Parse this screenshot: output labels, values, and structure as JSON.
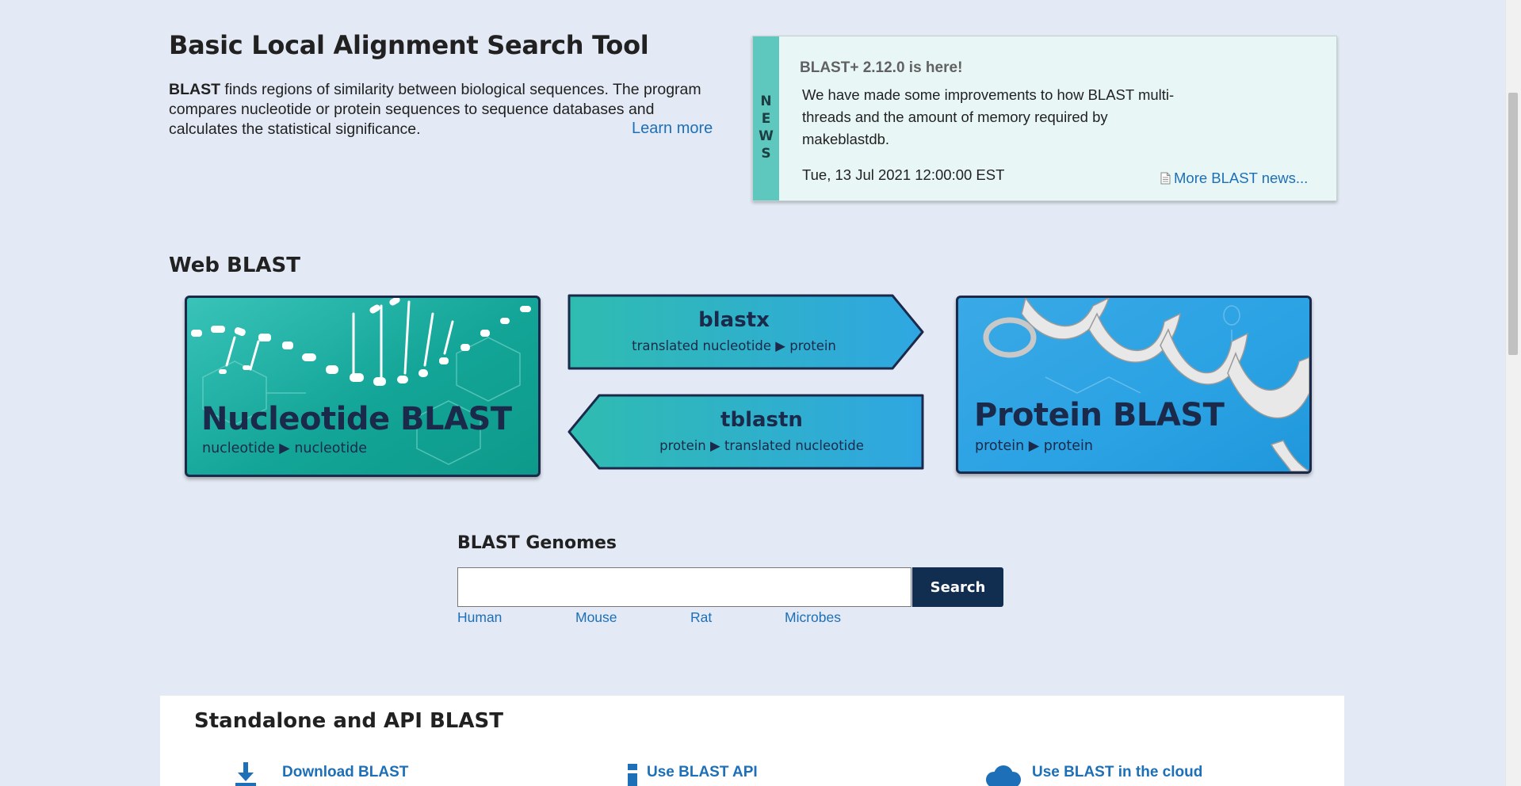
{
  "intro": {
    "title": "Basic Local Alignment Search Tool",
    "lead_bold": "BLAST",
    "lead_text": " finds regions of similarity between biological sequences. The program compares nucleotide or protein sequences to sequence databases and calculates the statistical significance.",
    "learn_more": "Learn more"
  },
  "news": {
    "strip_letters": [
      "N",
      "E",
      "W",
      "S"
    ],
    "headline": "BLAST+ 2.12.0 is here!",
    "body": "We have made some improvements to how BLAST multi-threads and the amount of memory required by makeblastdb.",
    "date": "Tue, 13 Jul 2021 12:00:00 EST",
    "more_link": "More BLAST news...",
    "more_icon": "document-icon"
  },
  "web_blast": {
    "title": "Web BLAST",
    "nucleotide": {
      "title": "Nucleotide BLAST",
      "subtitle": "nucleotide ▶ nucleotide"
    },
    "blastx": {
      "title": "blastx",
      "subtitle": "translated nucleotide ▶ protein"
    },
    "tblastn": {
      "title": "tblastn",
      "subtitle": "protein ▶ translated nucleotide"
    },
    "protein": {
      "title": "Protein BLAST",
      "subtitle": "protein ▶ protein"
    },
    "colors": {
      "teal": "#13a597",
      "blue": "#2aa2e3",
      "navy": "#1b2a4a"
    }
  },
  "genomes": {
    "title": "BLAST Genomes",
    "input_value": "",
    "input_placeholder": "",
    "search_label": "Search",
    "links": [
      "Human",
      "Mouse",
      "Rat",
      "Microbes"
    ]
  },
  "standalone": {
    "title": "Standalone and API BLAST",
    "links": [
      {
        "label": "Download BLAST",
        "icon": "download-icon"
      },
      {
        "label": "Use BLAST API",
        "icon": "info-icon"
      },
      {
        "label": "Use BLAST in the cloud",
        "icon": "cloud-icon"
      }
    ]
  },
  "theme": {
    "page_bg": "#e4eaf5",
    "link": "#1d6fb8",
    "button_bg": "#112e51"
  }
}
